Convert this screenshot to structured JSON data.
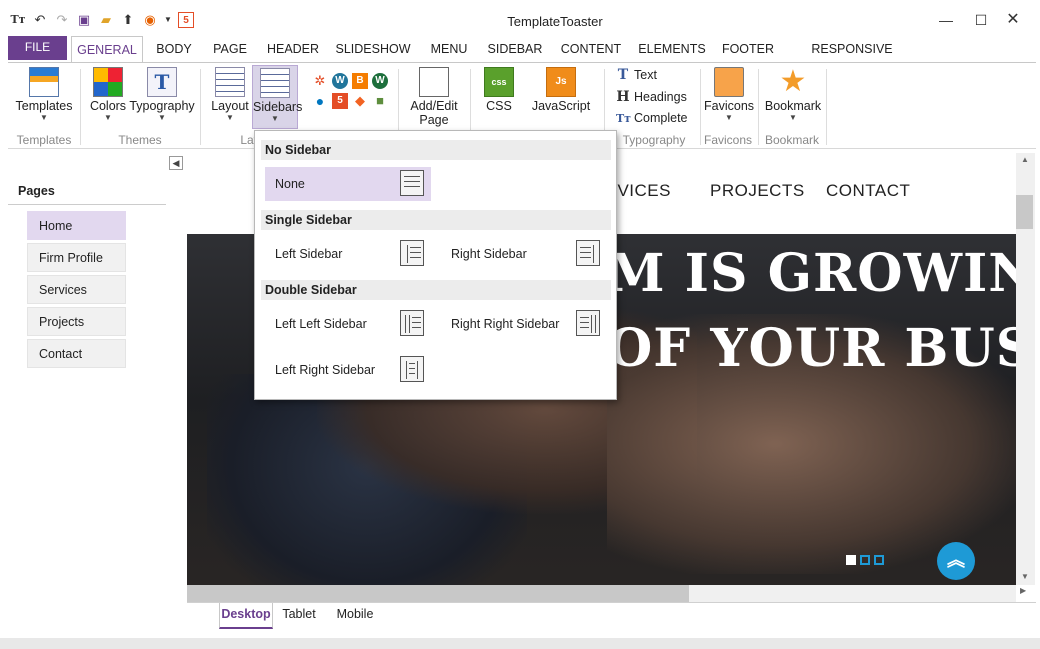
{
  "window": {
    "title": "TemplateToaster"
  },
  "quick_access": [
    "logo-icon",
    "undo-icon",
    "redo-icon",
    "save-icon",
    "open-folder-icon",
    "upload-icon",
    "firefox-icon",
    "html5-icon"
  ],
  "ribbon_tabs": [
    "FILE",
    "GENERAL",
    "BODY",
    "PAGE",
    "HEADER",
    "SLIDESHOW",
    "MENU",
    "SIDEBAR",
    "CONTENT",
    "ELEMENTS",
    "FOOTER",
    "RESPONSIVE LAYOUT"
  ],
  "ribbon": {
    "templates": "Templates",
    "colors": "Colors",
    "typography": "Typography",
    "layout": "Layout",
    "sidebars": "Sidebars",
    "add_edit_page": "Add/Edit\nPage",
    "css": "CSS",
    "javascript": "JavaScript",
    "text": "Text",
    "headings": "Headings",
    "complete": "Complete",
    "favicons": "Favicons",
    "bookmark": "Bookmark",
    "groups": {
      "templates": "Templates",
      "themes": "Themes",
      "layout": "Lay",
      "typography": "Typography",
      "favicons": "Favicons",
      "bookmark": "Bookmark"
    }
  },
  "pages_panel": {
    "title": "Pages",
    "items": [
      "Home",
      "Firm Profile",
      "Services",
      "Projects",
      "Contact"
    ],
    "selected": "Home"
  },
  "preview": {
    "nav": [
      "RVICES",
      "PROJECTS",
      "CONTACT"
    ],
    "hero_line1": "M IS GROWING A",
    "hero_line2": "OF YOUR BUSIN"
  },
  "sidebars_dropdown": {
    "sections": [
      {
        "title": "No Sidebar",
        "options": [
          "None"
        ]
      },
      {
        "title": "Single Sidebar",
        "options": [
          "Left Sidebar",
          "Right Sidebar"
        ]
      },
      {
        "title": "Double Sidebar",
        "options": [
          "Left Left Sidebar",
          "Right Right Sidebar",
          "Left Right Sidebar"
        ]
      }
    ],
    "selected": "None"
  },
  "device_tabs": [
    "Desktop",
    "Tablet",
    "Mobile"
  ],
  "device_selected": "Desktop",
  "colors": {
    "accent": "#6a3f8e",
    "hero_button": "#1e9ad6",
    "selection": "#e2d8ef"
  }
}
